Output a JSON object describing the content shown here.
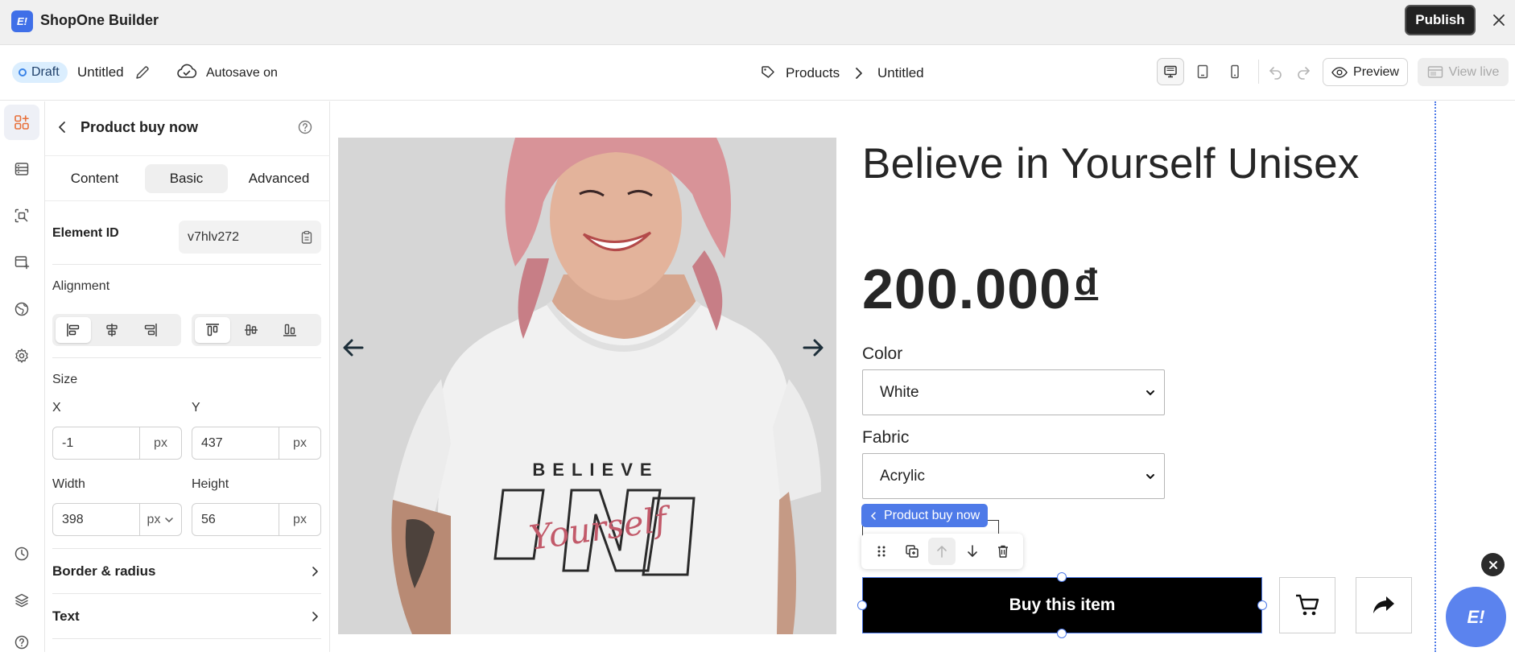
{
  "app": {
    "logo_text": "E!",
    "title": "ShopOne Builder",
    "publish_label": "Publish"
  },
  "topbar": {
    "status_badge": "Draft",
    "document_name": "Untitled",
    "autosave_label": "Autosave on",
    "breadcrumb": {
      "parent": "Products",
      "current": "Untitled"
    },
    "preview_label": "Preview",
    "view_live_label": "View live",
    "active_device": "desktop"
  },
  "panel": {
    "title": "Product buy now",
    "tabs": [
      "Content",
      "Basic",
      "Advanced"
    ],
    "active_tab": "Basic",
    "element_id_label": "Element ID",
    "element_id_value": "v7hlv272",
    "alignment_label": "Alignment",
    "size_label": "Size",
    "x_label": "X",
    "x_value": "-1",
    "x_unit": "px",
    "y_label": "Y",
    "y_value": "437",
    "y_unit": "px",
    "width_label": "Width",
    "width_value": "398",
    "width_unit": "px",
    "height_label": "Height",
    "height_value": "56",
    "height_unit": "px",
    "sections": [
      "Border & radius",
      "Text"
    ]
  },
  "canvas": {
    "product_title": "Believe in Yourself Unisex",
    "price": "200.000",
    "currency": "đ",
    "color_label": "Color",
    "color_value": "White",
    "fabric_label": "Fabric",
    "fabric_value": "Acrylic",
    "selection_tag": "Product buy now",
    "buy_button": "Buy this item",
    "shirt_print_top": "BELIEVE",
    "shirt_print_script": "Yourself"
  },
  "colors": {
    "accent": "#4e7ae8",
    "brand": "#3f6fe8",
    "buy_button_bg": "#000000"
  }
}
